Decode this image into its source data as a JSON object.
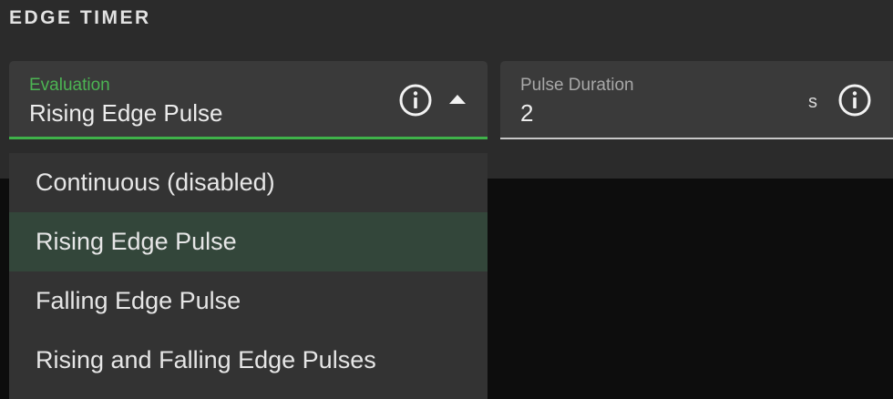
{
  "section": {
    "title": "EDGE TIMER"
  },
  "evaluation": {
    "label": "Evaluation",
    "value": "Rising Edge Pulse",
    "info_icon": "info-icon",
    "toggle_icon": "caret-up-icon",
    "accent": "#3fb24a"
  },
  "pulse_duration": {
    "label": "Pulse Duration",
    "value": "2",
    "unit": "s",
    "info_icon": "info-icon"
  },
  "dropdown": {
    "options": [
      {
        "label": "Continuous (disabled)",
        "selected": false
      },
      {
        "label": "Rising Edge Pulse",
        "selected": true
      },
      {
        "label": "Falling Edge Pulse",
        "selected": false
      },
      {
        "label": "Rising and Falling Edge Pulses",
        "selected": false
      }
    ],
    "selected_color": "#33463a"
  }
}
